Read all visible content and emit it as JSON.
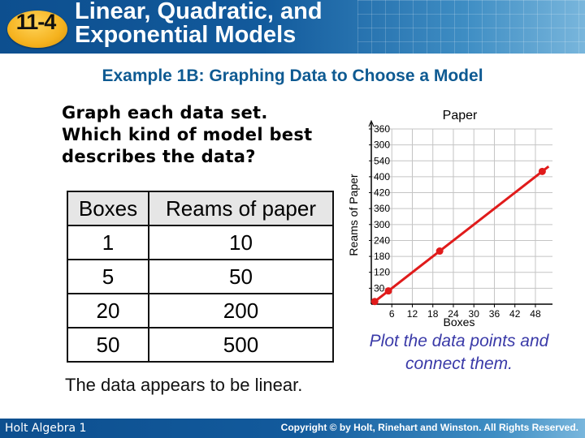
{
  "header": {
    "lesson_number": "11-4",
    "title_line1": "Linear, Quadratic, and",
    "title_line2": "Exponential Models",
    "brand_color": "#125a9c",
    "badge_color": "#f5b21e"
  },
  "subtitle": "Example 1B: Graphing Data to Choose a Model",
  "prompt": {
    "line1": "Graph each data set.",
    "line2": "Which kind of model best",
    "line3": "describes the data?"
  },
  "table": {
    "headers": [
      "Boxes",
      "Reams of paper"
    ],
    "rows": [
      [
        "1",
        "10"
      ],
      [
        "5",
        "50"
      ],
      [
        "20",
        "200"
      ],
      [
        "50",
        "500"
      ]
    ]
  },
  "note": {
    "line1": "Plot the data points and",
    "line2": "connect them."
  },
  "conclusion": "The data appears to be linear.",
  "footer": {
    "left": "Holt Algebra 1",
    "right": "Copyright © by Holt, Rinehart and Winston. All Rights Reserved."
  },
  "chart_data": {
    "type": "line",
    "title": "Paper",
    "xlabel": "Boxes",
    "ylabel": "Reams of Paper",
    "x": [
      1,
      5,
      20,
      50
    ],
    "series": [
      {
        "name": "Reams of paper",
        "values": [
          10,
          50,
          200,
          500
        ],
        "color": "#e01b1b"
      }
    ],
    "xlim": [
      0,
      53
    ],
    "ylim": [
      0,
      660
    ],
    "xticks": [
      6,
      12,
      18,
      24,
      30,
      36,
      42,
      48
    ],
    "xtick_labels": [
      "6",
      "12",
      "18",
      "24",
      "30",
      "36",
      "42",
      "48"
    ],
    "yticks": [
      60,
      120,
      180,
      240,
      300,
      360,
      420,
      480,
      540,
      600,
      660
    ],
    "ytick_labels": [
      "30",
      "120",
      "180",
      "240",
      "300",
      "360",
      "420",
      "400",
      "540",
      "300",
      "360"
    ],
    "grid": true,
    "legend": "none"
  }
}
